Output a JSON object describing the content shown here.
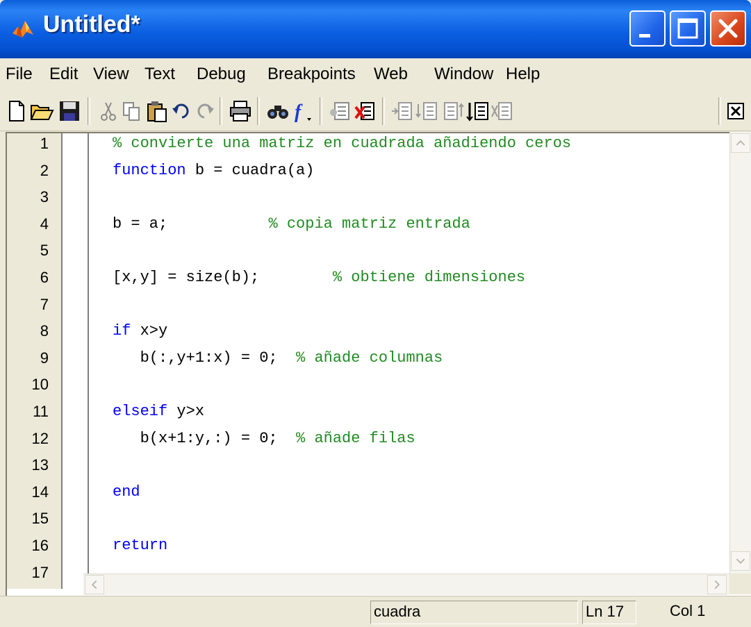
{
  "window": {
    "title": "Untitled*",
    "title_bar_color": "#0a5fd9",
    "buttons": [
      "minimize-icon",
      "maximize-icon",
      "close-icon"
    ]
  },
  "menu": {
    "items": [
      "File",
      "Edit",
      "View",
      "Text",
      "Debug",
      "Breakpoints",
      "Web",
      "Window",
      "Help"
    ]
  },
  "toolbar": {
    "icons": [
      "new-file-icon",
      "open-folder-icon",
      "save-icon",
      "cut-icon",
      "copy-icon",
      "paste-icon",
      "undo-icon",
      "redo-icon",
      "print-icon",
      "find-icon",
      "function-icon",
      "set-breakpoint-icon",
      "clear-breakpoint-icon",
      "step-icon",
      "step-in-icon",
      "step-out-icon",
      "continue-icon",
      "exit-debug-icon",
      "close-editor-icon"
    ]
  },
  "editor": {
    "line_numbers": [
      "1",
      "2",
      "3",
      "4",
      "5",
      "6",
      "7",
      "8",
      "9",
      "10",
      "11",
      "12",
      "13",
      "14",
      "15",
      "16",
      "17"
    ],
    "lines": [
      [
        {
          "t": "% convierte una matriz en cuadrada añadiendo ceros",
          "c": "comment"
        }
      ],
      [
        {
          "t": "function",
          "c": "keyword"
        },
        {
          "t": " b = cuadra(a)",
          "c": "plain"
        }
      ],
      [],
      [
        {
          "t": "b = a;",
          "c": "plain"
        },
        {
          "t": "           % copia matriz entrada",
          "c": "comment"
        }
      ],
      [],
      [
        {
          "t": "[x,y] = size(b);",
          "c": "plain"
        },
        {
          "t": "        % obtiene dimensiones",
          "c": "comment"
        }
      ],
      [],
      [
        {
          "t": "if",
          "c": "keyword"
        },
        {
          "t": " x>y",
          "c": "plain"
        }
      ],
      [
        {
          "t": "   b(:,y+1:x) = 0;",
          "c": "plain"
        },
        {
          "t": "  % añade columnas",
          "c": "comment"
        }
      ],
      [],
      [
        {
          "t": "elseif",
          "c": "keyword"
        },
        {
          "t": " y>x",
          "c": "plain"
        }
      ],
      [
        {
          "t": "   b(x+1:y,:) = 0;",
          "c": "plain"
        },
        {
          "t": "  % añade filas",
          "c": "comment"
        }
      ],
      [],
      [
        {
          "t": "end",
          "c": "keyword"
        }
      ],
      [],
      [
        {
          "t": "return",
          "c": "keyword"
        }
      ],
      []
    ],
    "colors": {
      "comment": "#228b22",
      "keyword": "#0000ff",
      "plain": "#000000"
    }
  },
  "status": {
    "function_name": "cuadra",
    "line": "Ln 17",
    "column": "Col 1"
  }
}
